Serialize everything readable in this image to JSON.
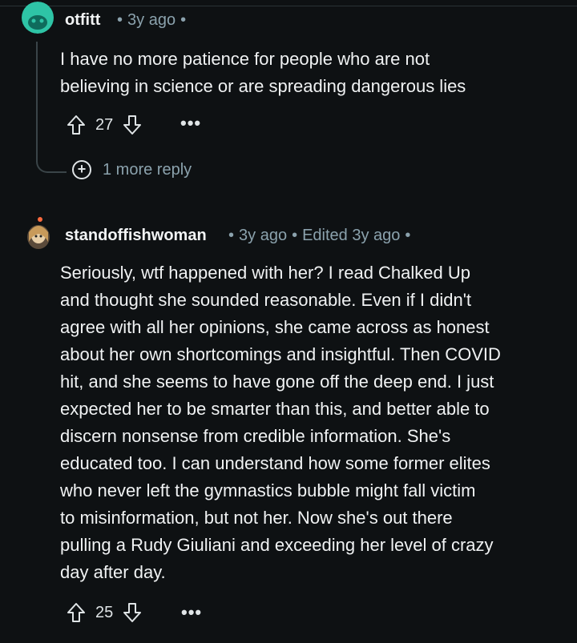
{
  "comments": [
    {
      "username": "otfitt",
      "timestamp": "3y ago",
      "edited": "",
      "body_lines": [
        "I have no more patience for people who are not",
        "believing in science or are spreading dangerous lies"
      ],
      "score": "27",
      "more_label": "•••",
      "reply_label": "1 more reply",
      "avatar_icon": "snoo-avatar-icon",
      "avatar_color": "#2ec4a6"
    },
    {
      "username": "standoffishwoman",
      "timestamp": "3y ago",
      "edited": "Edited 3y ago",
      "body_lines": [
        "Seriously, wtf happened with her? I read Chalked Up",
        "and thought she sounded reasonable. Even if I didn't",
        "agree with all her opinions, she came across as honest",
        "about her own shortcomings and insightful. Then COVID",
        "hit, and she seems to have gone off the deep end. I just",
        "expected her to be smarter than this, and better able to",
        "discern nonsense from credible information. She's",
        "educated too. I can understand how some former elites",
        "who never left the gymnastics bubble might fall victim",
        "to misinformation, but not her. Now she's out there",
        "pulling a Rudy Giuliani and exceeding her level of crazy",
        "day after day."
      ],
      "score": "25",
      "more_label": "•••",
      "avatar_icon": "custom-avatar-icon",
      "avatar_color": "#c89a5a"
    }
  ],
  "separator": "•",
  "icons": {
    "upvote": "upvote-arrow-icon",
    "downvote": "downvote-arrow-icon",
    "expand": "plus-circle-icon"
  }
}
